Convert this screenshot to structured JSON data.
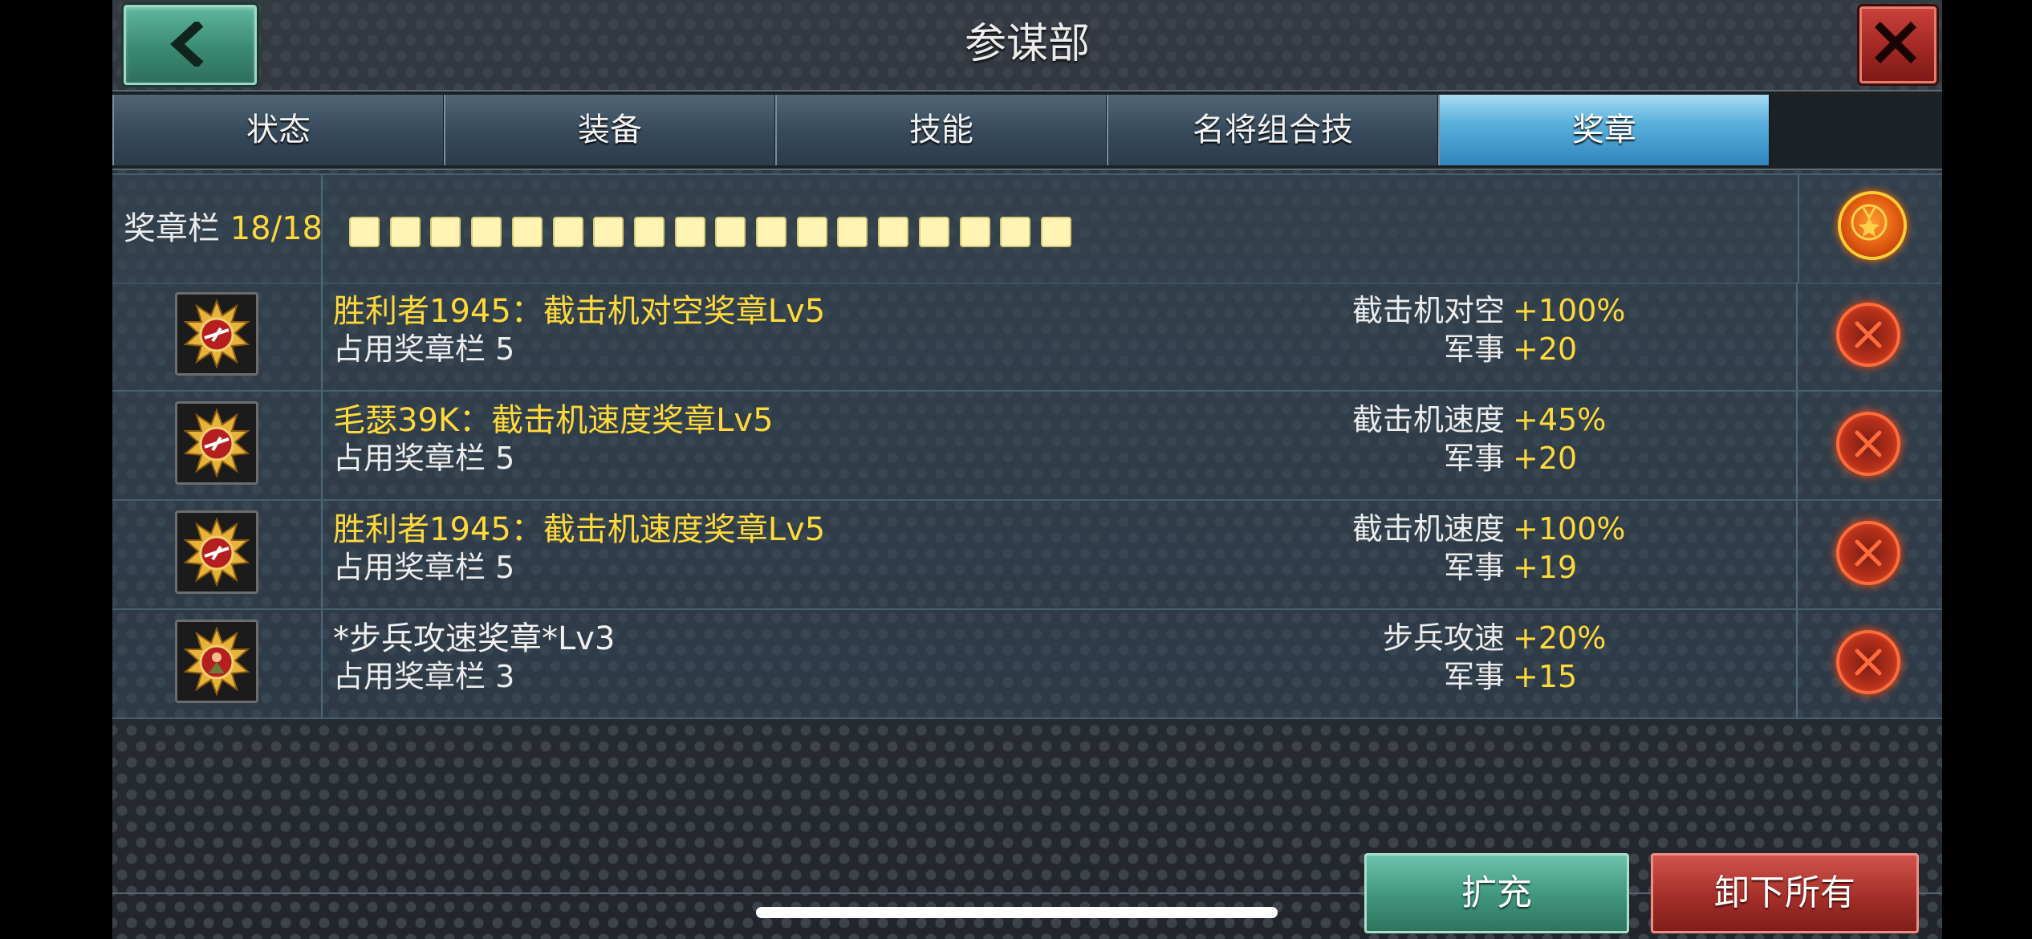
{
  "header": {
    "title": "参谋部"
  },
  "tabs": [
    {
      "label": "状态"
    },
    {
      "label": "装备"
    },
    {
      "label": "技能"
    },
    {
      "label": "名将组合技"
    },
    {
      "label": "奖章"
    }
  ],
  "active_tab": "奖章",
  "slots": {
    "label": "奖章栏",
    "count": "18/18",
    "filled": 18,
    "total": 18
  },
  "medals": [
    {
      "name": "胜利者1945：截击机对空奖章Lv5",
      "slots": "占用奖章栏 5",
      "stat1_name": "截击机对空",
      "stat1_value": "+100%",
      "stat2_name": "军事",
      "stat2_value": "+20"
    },
    {
      "name": "毛瑟39K：截击机速度奖章Lv5",
      "slots": "占用奖章栏 5",
      "stat1_name": "截击机速度",
      "stat1_value": "+45%",
      "stat2_name": "军事",
      "stat2_value": "+20"
    },
    {
      "name": "胜利者1945：截击机速度奖章Lv5",
      "slots": "占用奖章栏 5",
      "stat1_name": "截击机速度",
      "stat1_value": "+100%",
      "stat2_name": "军事",
      "stat2_value": "+19"
    },
    {
      "name": "*步兵攻速奖章*Lv3",
      "slots": "占用奖章栏 3",
      "stat1_name": "步兵攻速",
      "stat1_value": "+20%",
      "stat2_name": "军事",
      "stat2_value": "+15"
    }
  ],
  "buttons": {
    "expand": "扩充",
    "unload_all": "卸下所有"
  },
  "colors": {
    "accent_yellow": "#ffd93a",
    "active_tab": "#5ab0dc",
    "green_button": "#3f957b",
    "red_button": "#a52f29"
  }
}
